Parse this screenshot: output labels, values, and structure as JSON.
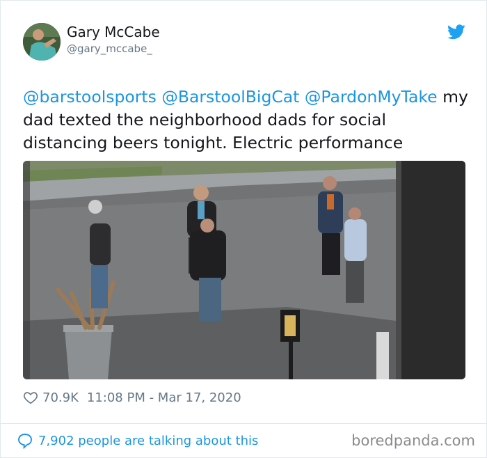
{
  "tweet": {
    "author": {
      "display_name": "Gary McCabe",
      "handle": "@gary_mccabe_",
      "avatar_icon": "avatar-photo"
    },
    "text": {
      "mention_1": "@barstoolsports",
      "mention_2": "@BarstoolBigCat",
      "mention_3": "@PardonMyTake",
      "body": "my dad texted the neighborhood dads for social distancing beers tonight. Electric performance"
    },
    "media": {
      "icon": "street-photo"
    },
    "likes": "70.9K",
    "timestamp": "11:08 PM - Mar 17, 2020",
    "talking": "7,902 people are talking about this"
  },
  "platform": {
    "icon": "twitter-bird-icon",
    "color": "#1da1f2"
  },
  "watermark": {
    "text": "boredpanda.com"
  },
  "colors": {
    "link": "#1b95e0",
    "muted": "#657786",
    "text": "#14171a"
  }
}
